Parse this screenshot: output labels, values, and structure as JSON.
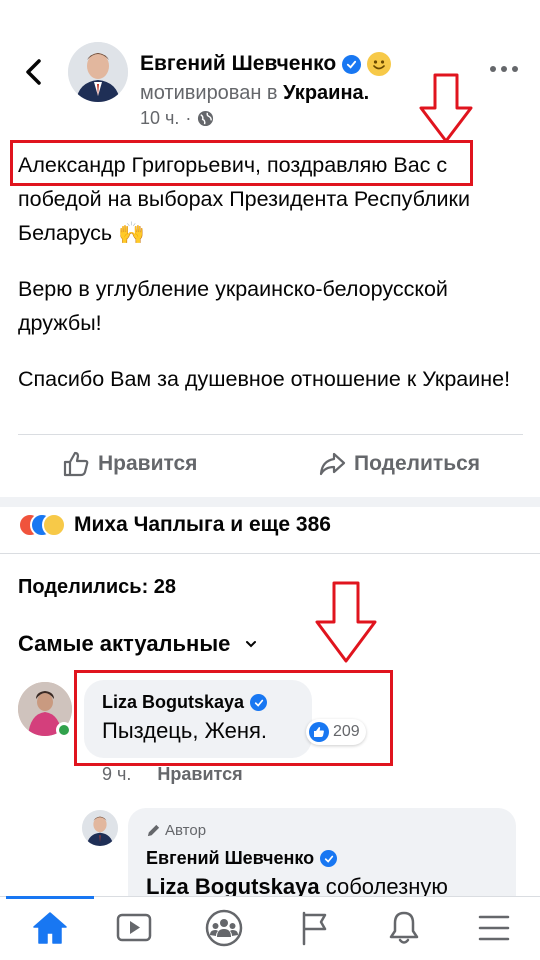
{
  "post": {
    "author": "Евгений Шевченко",
    "activity_prefix": "мотивирован в",
    "location": "Украина.",
    "time": "10 ч.",
    "paragraphs": [
      "Александр Григорьевич, поздравляю Вас с победой на  выборах Президента Республики Беларусь",
      "Верю в углубление украинско-белорусской дружбы!",
      "Спасибо Вам за душевное отношение к Украине!"
    ],
    "emoji_after_p1": "🙌"
  },
  "actions": {
    "like_label": "Нравится",
    "share_label": "Поделиться"
  },
  "reactions": {
    "text": "Миха Чаплыга и еще 386"
  },
  "shares": {
    "text": "Поделились: 28"
  },
  "comments_filter": {
    "label": "Самые актуальные"
  },
  "comment": {
    "author": "Liza Bogutskaya",
    "text": "Пыздець, Женя.",
    "likes": "209",
    "time": "9 ч.",
    "like_label": "Нравится"
  },
  "reply": {
    "tag": "Автор",
    "author": "Евгений Шевченко",
    "mention": "Liza Bogutskaya",
    "text_rest": " соболезную"
  },
  "colors": {
    "accent": "#1877f2",
    "annotation_red": "#e0141e",
    "secondary_text": "#65676b",
    "online": "#31a24c"
  },
  "icons": {
    "back": "chevron-left-icon",
    "verified": "verified-badge-icon",
    "smile": "smile-emoji-icon",
    "globe": "globe-icon",
    "more": "more-dots-icon",
    "like": "thumbs-up-icon",
    "share": "share-arrow-icon",
    "tab_home": "home-icon",
    "tab_watch": "video-icon",
    "tab_groups": "groups-icon",
    "tab_pages": "flag-icon",
    "tab_notifications": "bell-icon",
    "tab_menu": "menu-icon"
  }
}
